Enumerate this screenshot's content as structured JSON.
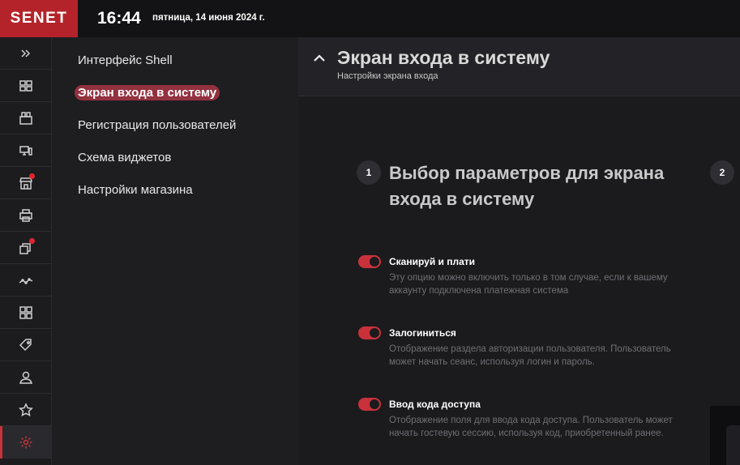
{
  "header": {
    "logo": "SENET",
    "time": "16:44",
    "date": "пятница, 14 июня 2024 г."
  },
  "rail": {
    "items": [
      {
        "icon": "expand-icon"
      },
      {
        "icon": "computers-icon"
      },
      {
        "icon": "printer-layout-icon"
      },
      {
        "icon": "devices-icon"
      },
      {
        "icon": "shop-icon",
        "badge": true
      },
      {
        "icon": "print-icon"
      },
      {
        "icon": "layers-icon",
        "badge": true
      },
      {
        "icon": "graph-icon"
      },
      {
        "icon": "widgets-icon"
      },
      {
        "icon": "tag-settings-icon"
      },
      {
        "icon": "user-icon"
      },
      {
        "icon": "star-icon"
      },
      {
        "icon": "gear-icon",
        "active": true
      }
    ],
    "accent": "#c9323a"
  },
  "subnav": {
    "items": [
      {
        "label": "Интерфейс Shell"
      },
      {
        "label": "Экран входа в систему"
      },
      {
        "label": "Регистрация пользователей"
      },
      {
        "label": "Схема виджетов"
      },
      {
        "label": "Настройки магазина"
      }
    ]
  },
  "content": {
    "title": "Экран входа в систему",
    "subtitle": "Настройки экрана входа",
    "step1": {
      "number": "1",
      "title": "Выбор параметров для экрана входа в систему"
    },
    "step2": {
      "number": "2"
    },
    "options": [
      {
        "title": "Сканируй и плати",
        "description": "Эту опцию можно включить только в том случае, если к вашему аккаунту подключена платежная система",
        "enabled": true
      },
      {
        "title": "Залогиниться",
        "description": "Отображение раздела авторизации пользователя. Пользователь может начать сеанс, используя логин и пароль.",
        "enabled": true
      },
      {
        "title": "Ввод кода доступа",
        "description": "Отображение поля для ввода кода доступа. Пользователь может начать гостевую сессию, используя код, приобретенный ранее.",
        "enabled": true
      }
    ]
  }
}
